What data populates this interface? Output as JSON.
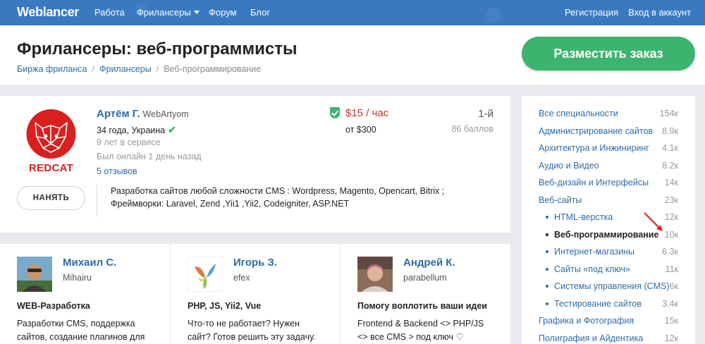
{
  "nav": {
    "logo": "Weblancer",
    "links": [
      "Работа",
      "Фрилансеры",
      "Форум",
      "Блог"
    ],
    "register": "Регистрация",
    "login": "Вход в аккаунт"
  },
  "header": {
    "title": "Фрилансеры: веб-программисты",
    "breadcrumb": [
      "Биржа фриланса",
      "Фрилансеры",
      "Веб-программирование"
    ],
    "order_button": "Разместить заказ"
  },
  "featured": {
    "logo_text": "REDCAT",
    "name": "Артём Г.",
    "login": "WebArtyom",
    "age_location": "34 года, Украина",
    "service": "9 лет в сервисе",
    "online": "Был онлайн 1 день назад",
    "reviews": "5 отзывов",
    "rate": "$15 / час",
    "min_price": "от $300",
    "rank": "1-й",
    "points": "86 баллов",
    "hire_button": "НАНЯТЬ",
    "description": "Разработка сайтов любой сложности CMS : Wordpress, Magento, Opencart, Bitrix ; Фреймворки: Laravel, Zend ,Yii1 ,Yii2, Codeigniter, ASP.NET"
  },
  "freelancers": [
    {
      "name": "Михаил С.",
      "login": "Mihairu",
      "title": "WEB-Разработка",
      "desc": "Разработки CMS, поддержка сайтов, создание плагинов для"
    },
    {
      "name": "Игорь З.",
      "login": "efex",
      "title": "PHP, JS, Yii2, Vue",
      "desc": "Что-то не работает? Нужен сайт? Готов решить эту задачу."
    },
    {
      "name": "Андрей К.",
      "login": "parabellum",
      "title": "Помогу воплотить ваши идеи",
      "desc": "Frontend & Backend <> PHP/JS <> все CMS > под ключ ♡ Laravel +"
    }
  ],
  "sidebar": {
    "items": [
      {
        "label": "Все специальности",
        "count": "154к"
      },
      {
        "label": "Администрирование сайтов",
        "count": "8.9к"
      },
      {
        "label": "Архитектура и Инжиниринг",
        "count": "4.1к"
      },
      {
        "label": "Аудио и Видео",
        "count": "8.2к"
      },
      {
        "label": "Веб-дизайн и Интерфейсы",
        "count": "14к"
      },
      {
        "label": "Веб-сайты",
        "count": "23к"
      },
      {
        "label": "HTML-верстка",
        "count": "12к"
      },
      {
        "label": "Веб-программирование",
        "count": "10к"
      },
      {
        "label": "Интернет-магазины",
        "count": "6.3к"
      },
      {
        "label": "Сайты «под ключ»",
        "count": "11к"
      },
      {
        "label": "Системы управления (CMS)",
        "count": "6к"
      },
      {
        "label": "Тестирование сайтов",
        "count": "3.4к"
      },
      {
        "label": "Графика и Фотография",
        "count": "15к"
      },
      {
        "label": "Полиграфия и Айдентика",
        "count": "12к"
      }
    ]
  },
  "colors": {
    "nav_bg": "#3a79c0",
    "link": "#2e6ca8",
    "accent_green": "#3cb46e",
    "price_red": "#c0392b",
    "logo_red": "#d8201f"
  }
}
